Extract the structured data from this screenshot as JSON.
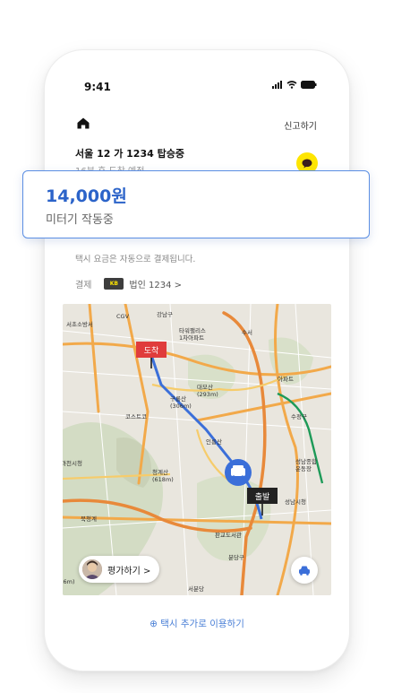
{
  "status_bar": {
    "time": "9:41"
  },
  "header": {
    "report_label": "신고하기"
  },
  "trip": {
    "plate_status": "서울 12 가 1234 탑승중",
    "eta": "16분 후 도착 예정"
  },
  "fare": {
    "amount": "14,000원",
    "meter_status": "미터기 작동중"
  },
  "payment": {
    "note": "택시 요금은 자동으로 결제됩니다.",
    "label": "결제",
    "card_badge": "KB",
    "method": "법인 1234 >"
  },
  "map": {
    "destination_label": "도착",
    "origin_label": "출발",
    "place_labels": {
      "cgv": "CGV",
      "gangnam": "강남구",
      "tower_palace": "타워팰리스",
      "tower_palace_2": "1차아파트",
      "suseo": "수서",
      "seocho_office": "서초소방서",
      "seocho": "서초구",
      "wuryeon": "(293m)",
      "costco": "코스트코",
      "daemosan": "대모산",
      "daemosan_h": "(293m)",
      "gurongsan": "구룡산",
      "gurongsan_h": "(306m)",
      "guro_sub": "내곡",
      "apartment": "아파트",
      "sujeong": "수정구",
      "inreung": "인릉산",
      "gwacheon": "과천시청",
      "cheonggye": "청계산",
      "cheonggye_h": "(618m)",
      "seongnam_hall": "성남시청",
      "seongnam_stadium": "성남종합",
      "seongnam_stadium_2": "운동장",
      "pangyo": "판교도서관",
      "bukcheong": "북청계",
      "bundang": "분당구",
      "seobundang": "서분당",
      "hs": "(6m)",
      "yeonghae": "의왕"
    }
  },
  "rating": {
    "label": "평가하기 >"
  },
  "footer": {
    "add_taxi_label": "⊕ 택시 추가로 이용하기"
  },
  "colors": {
    "accent": "#2b63c9",
    "kakao_yellow": "#fee500",
    "destination_red": "#e03c3c",
    "route_blue": "#3b6fd9"
  }
}
